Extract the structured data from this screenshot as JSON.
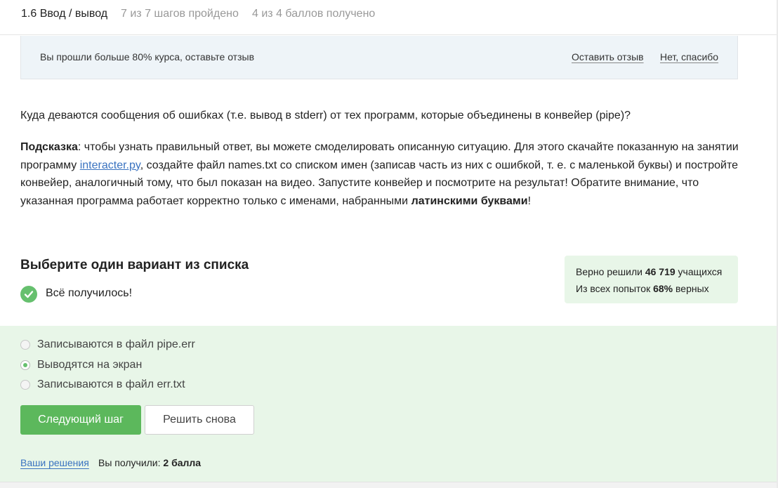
{
  "header": {
    "step_title": "1.6 Ввод / вывод",
    "steps_progress": "7 из 7 шагов пройдено",
    "score_progress": "4 из 4 баллов  получено"
  },
  "feedback_banner": {
    "text": "Вы прошли больше 80% курса, оставьте отзыв",
    "leave_review": "Оставить отзыв",
    "decline": "Нет, спасибо"
  },
  "question": {
    "text": "Куда деваются сообщения об ошибках (т.е. вывод в stderr) от тех программ, которые объединены в конвейер (pipe)?"
  },
  "hint": {
    "label": "Подсказка",
    "part1": ": чтобы узнать правильный ответ, вы можете смоделировать описанную ситуацию. Для этого скачайте показанную на занятии программу ",
    "link": "interacter.py",
    "part2": ", создайте файл names.txt со списком имен (записав часть из них с ошибкой, т. е. с маленькой буквы) и постройте конвейер, аналогичный тому, что был показан на видео. Запустите конвейер и посмотрите на результат! Обратите внимание, что указанная программа работает корректно только с именами, набранными ",
    "bold_end": "латинскими буквами",
    "end": "!"
  },
  "quiz": {
    "title": "Выберите один вариант из списка",
    "success": "Всё получилось!",
    "options": [
      {
        "label": "Записываются в файл pipe.err",
        "checked": false
      },
      {
        "label": "Выводятся на экран",
        "checked": true
      },
      {
        "label": "Записываются в файл err.txt",
        "checked": false
      }
    ],
    "next_button": "Следующий шаг",
    "retry_button": "Решить снова",
    "solutions_link": "Ваши решения",
    "score_prefix": "Вы получили: ",
    "score_value": "2 балла"
  },
  "stats": {
    "line1_prefix": "Верно решили ",
    "line1_value": "46 719",
    "line1_suffix": " учащихся",
    "line2_prefix": "Из всех попыток ",
    "line2_value": "68%",
    "line2_suffix": " верных"
  },
  "colors": {
    "accent_green": "#5cb85c",
    "success_green": "#66c06e",
    "answer_background": "#e8f6e8",
    "banner_background": "#eef4f8",
    "link_blue": "#3a73c0"
  },
  "icons": {
    "success": "check-circle-icon"
  }
}
